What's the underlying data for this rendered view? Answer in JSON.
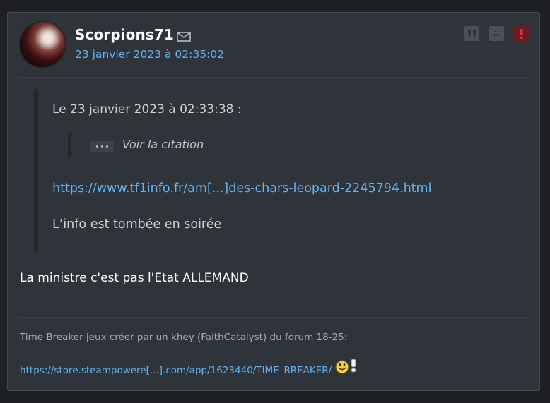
{
  "post": {
    "author": "Scorpions71",
    "date": "23 janvier 2023 à 02:35:02",
    "actions": {
      "quote_icon": "quote-icon",
      "sad_icon": "sad-face-icon",
      "alert_icon": "alert-icon"
    },
    "quote": {
      "header": "Le 23 janvier 2023 à 02:33:38 :",
      "nested_label": "Voir la citation",
      "link": "https://www.tf1info.fr/am[...]des-chars-leopard-2245794.html",
      "text": "L’info est tombée en soirée"
    },
    "body": "La ministre c'est pas l'Etat ALLEMAND",
    "signature": {
      "text": "Time Breaker jeux créer par un khey (FaithCatalyst) du forum 18-25:",
      "link": "https://store.steampowere[...].com/app/1623440/TIME_BREAKER/"
    }
  },
  "colors": {
    "background": "#1e2023",
    "card": "#2f333a",
    "link": "#63b3ef",
    "alert": "#6a1c1f"
  }
}
